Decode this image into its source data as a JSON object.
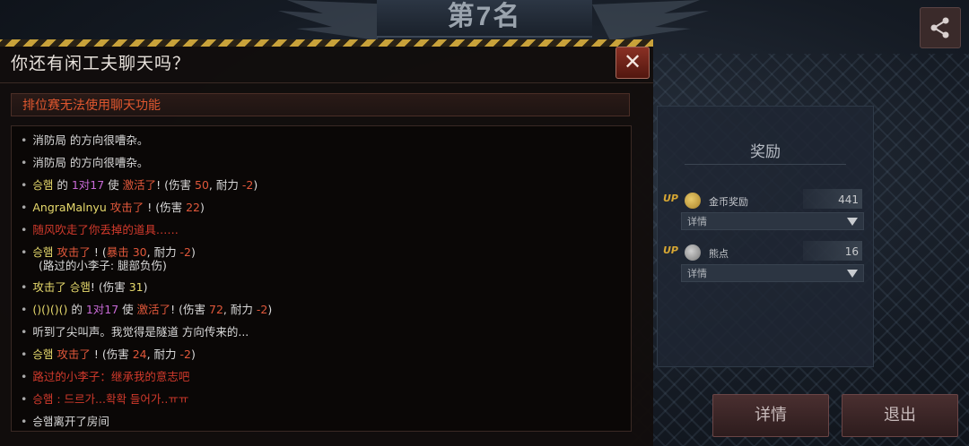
{
  "rank": {
    "title": "第7名"
  },
  "reward_panel": {
    "title": "奖励",
    "rows": [
      {
        "up": "UP",
        "icon": "coin-icon",
        "label": "金币奖励",
        "value": "441",
        "detail": "详情"
      },
      {
        "up": "UP",
        "icon": "points-icon",
        "label": "熊点",
        "value": "16",
        "detail": "详情"
      }
    ]
  },
  "buttons": {
    "details": "详情",
    "exit": "退出"
  },
  "dialog": {
    "title": "你还有闲工夫聊天吗？",
    "close_label": "✕",
    "notice": "排位赛无法使用聊天功能",
    "messages": [
      {
        "bullet": "•",
        "parts": [
          "消防局 的方向很嘈杂。"
        ]
      },
      {
        "bullet": "•",
        "parts": [
          "消防局 的方向很嘈杂。"
        ]
      },
      {
        "bullet": "•",
        "parts": [
          "승햄",
          " 的 ",
          "1对17",
          " 使  ",
          "激活了",
          "! (伤害 ",
          "50",
          ",  耐力  ",
          "-2",
          ")"
        ]
      },
      {
        "bullet": "•",
        "parts": [
          "AngraMalnyu",
          "  ",
          "攻击了",
          " ! (伤害 ",
          "22",
          ")"
        ]
      },
      {
        "bullet": "•",
        "parts": [
          "随风吹走了你丢掉的道具……"
        ]
      },
      {
        "bullet": "•",
        "parts": [
          "승햄",
          "  ",
          "攻击了",
          " ! (",
          "暴击 30",
          ",  耐力  ",
          "-2",
          ")"
        ],
        "sub": "(路过的小李子: 腿部负伤)"
      },
      {
        "bullet": "•",
        "parts": [
          "攻击了 승햄",
          "! (伤害 ",
          "31",
          ")"
        ]
      },
      {
        "bullet": "•",
        "parts": [
          "()()()()",
          " 的 ",
          "1对17",
          " 使  ",
          "激活了",
          "! (伤害 ",
          "72",
          ",  耐力  ",
          "-2",
          ")"
        ]
      },
      {
        "bullet": "•",
        "parts": [
          "听到了尖叫声。我觉得是隧道 方向传来的..."
        ]
      },
      {
        "bullet": "•",
        "parts": [
          "승햄",
          "  ",
          "攻击了",
          " ! (伤害 ",
          "24",
          ",  耐力  ",
          "-2",
          ")"
        ]
      },
      {
        "bullet": "•",
        "parts": [
          "路过的小李子：继承我的意志吧"
        ]
      },
      {
        "bullet": "•",
        "parts": [
          "승햄 : 드르가...확확 들어가..ㅠㅠ"
        ]
      },
      {
        "bullet": "•",
        "parts": [
          "승햄离开了房间"
        ]
      }
    ]
  },
  "colors": {
    "accent": "#e0572f",
    "kill_name": "#e6d96c",
    "skill": "#c86ad6",
    "hazard": "#c9a23a"
  }
}
